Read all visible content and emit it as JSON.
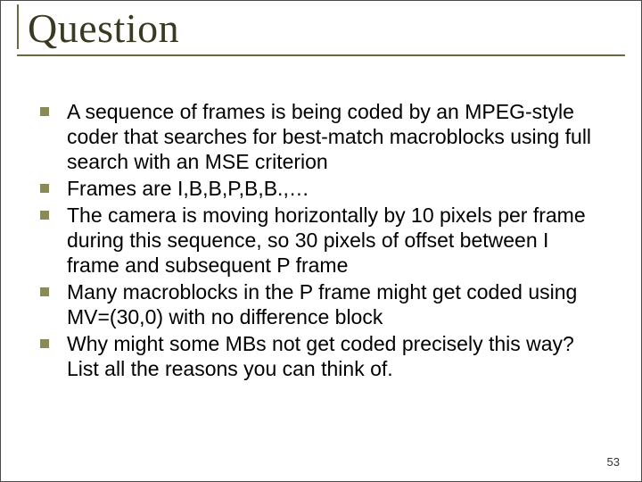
{
  "title": "Question",
  "bullets": [
    "A sequence of frames is being coded by an MPEG-style coder that searches for best-match macroblocks using full search with an MSE criterion",
    "Frames are I,B,B,P,B,B.,…",
    "The camera is moving horizontally by 10 pixels per frame during this sequence, so 30 pixels of offset between I frame and subsequent P frame",
    "Many macroblocks in the P frame might get coded using MV=(30,0) with no difference block",
    "Why might some MBs not get coded precisely this way?  List all the reasons you can think of."
  ],
  "page_number": "53"
}
